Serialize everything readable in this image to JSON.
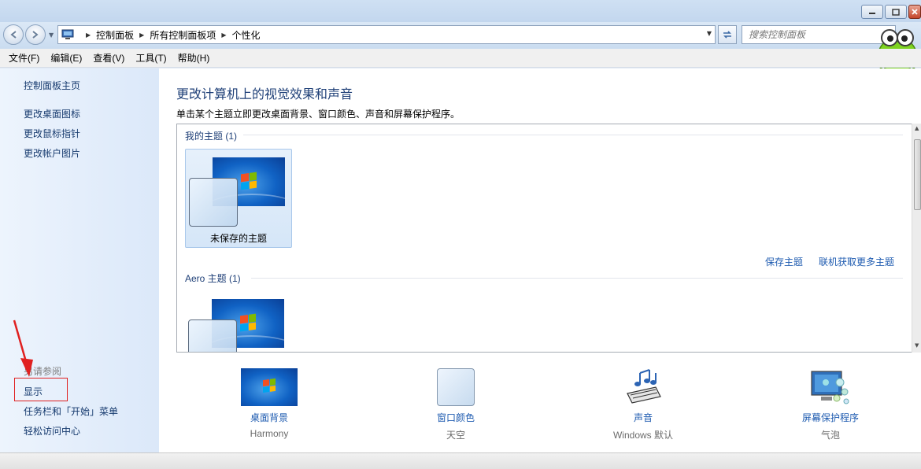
{
  "window": {
    "controls": {
      "minimize": "—",
      "maximize": "□",
      "close": "×"
    }
  },
  "nav": {
    "back_icon": "back-arrow-icon",
    "forward_icon": "forward-arrow-icon",
    "breadcrumbs": [
      "控制面板",
      "所有控制面板项",
      "个性化"
    ],
    "search_placeholder": "搜索控制面板"
  },
  "menu": [
    "文件(F)",
    "编辑(E)",
    "查看(V)",
    "工具(T)",
    "帮助(H)"
  ],
  "sidebar": {
    "home": "控制面板主页",
    "links": [
      "更改桌面图标",
      "更改鼠标指针",
      "更改帐户图片"
    ],
    "see_also_heading": "另请参阅",
    "see_also": [
      "显示",
      "任务栏和「开始」菜单",
      "轻松访问中心"
    ],
    "highlight_color": "#e02020"
  },
  "main": {
    "title": "更改计算机上的视觉效果和声音",
    "subtitle": "单击某个主题立即更改桌面背景、窗口颜色、声音和屏幕保护程序。",
    "groups": [
      {
        "label": "我的主题 (1)",
        "themes": [
          "未保存的主题"
        ]
      },
      {
        "label": "Aero 主题 (1)",
        "themes": [
          ""
        ]
      }
    ],
    "links": {
      "save_theme": "保存主题",
      "more_themes": "联机获取更多主题"
    }
  },
  "bottom": [
    {
      "label": "桌面背景",
      "value": "Harmony",
      "icon": "desktop-background-icon"
    },
    {
      "label": "窗口颜色",
      "value": "天空",
      "icon": "window-color-icon"
    },
    {
      "label": "声音",
      "value": "Windows 默认",
      "icon": "sound-icon"
    },
    {
      "label": "屏幕保护程序",
      "value": "气泡",
      "icon": "screensaver-icon"
    }
  ],
  "colors": {
    "link": "#1e5bb0",
    "title": "#1e3f77",
    "accent_blue": "#1062c4"
  }
}
